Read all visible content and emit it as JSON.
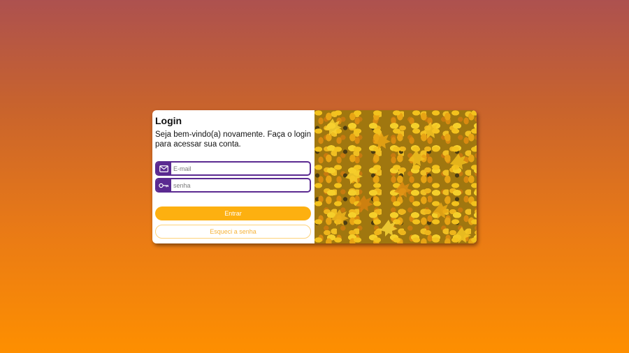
{
  "login": {
    "title": "Login",
    "subtitle": "Seja bem-vindo(a) novamente. Faça o login para acessar sua conta.",
    "email_placeholder": "E-mail",
    "password_placeholder": "senha",
    "submit_label": "Entrar",
    "forgot_label": "Esqueci a senha"
  },
  "icons": {
    "email": "envelope-icon",
    "password": "key-icon"
  },
  "colors": {
    "accent_purple": "#5b2a91",
    "button_yellow": "#fdb010",
    "background_top": "#ad514f",
    "background_bottom": "#fe8f00"
  }
}
